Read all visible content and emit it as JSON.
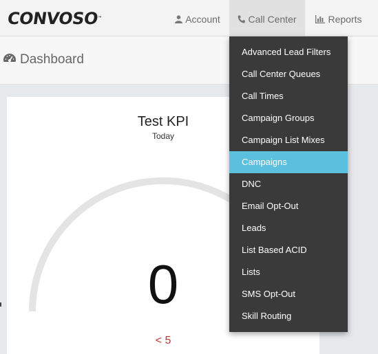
{
  "brand": {
    "logo_text": "CONVOSO",
    "logo_mark": "™"
  },
  "nav": {
    "account": {
      "label": "Account",
      "icon": "user-icon"
    },
    "call_center": {
      "label": "Call Center",
      "icon": "phone-icon"
    },
    "reports": {
      "label": "Reports",
      "icon": "bar-chart-icon"
    }
  },
  "page": {
    "title": "Dashboard",
    "icon": "dashboard-gauge-icon"
  },
  "kpi": {
    "title": "Test KPI",
    "subtitle": "Today",
    "value": "0",
    "target": "< 5"
  },
  "dropdown": {
    "items": [
      {
        "label": "Advanced Lead Filters",
        "active": false
      },
      {
        "label": "Call Center Queues",
        "active": false
      },
      {
        "label": "Call Times",
        "active": false
      },
      {
        "label": "Campaign Groups",
        "active": false
      },
      {
        "label": "Campaign List Mixes",
        "active": false
      },
      {
        "label": "Campaigns",
        "active": true
      },
      {
        "label": "DNC",
        "active": false
      },
      {
        "label": "Email Opt-Out",
        "active": false
      },
      {
        "label": "Leads",
        "active": false
      },
      {
        "label": "List Based ACID",
        "active": false
      },
      {
        "label": "Lists",
        "active": false
      },
      {
        "label": "SMS Opt-Out",
        "active": false
      },
      {
        "label": "Skill Routing",
        "active": false
      }
    ],
    "active_color": "#5bc0de"
  },
  "colors": {
    "target": "#c0392b",
    "dropdown_bg": "#3a3a3a"
  }
}
